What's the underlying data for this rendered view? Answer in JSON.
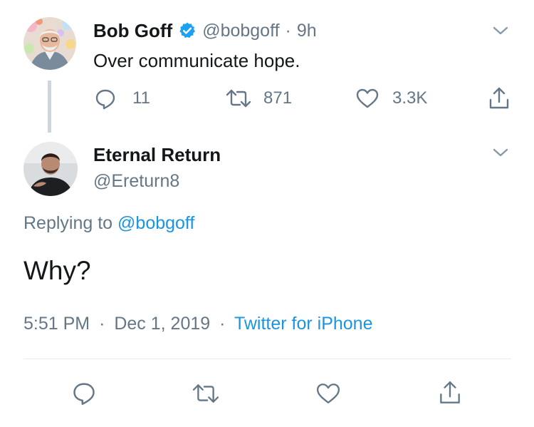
{
  "parent_tweet": {
    "author_name": "Bob Goff",
    "handle": "@bobgoff",
    "separator": "·",
    "time": "9h",
    "text": "Over communicate hope.",
    "verified_icon": "verified-badge-icon",
    "counts": {
      "replies": "11",
      "retweets": "871",
      "likes": "3.3K"
    }
  },
  "reply_tweet": {
    "author_name": "Eternal Return",
    "handle": "@Ereturn8",
    "replying_prefix": "Replying to",
    "replying_handle": "@bobgoff",
    "text": "Why?",
    "timestamp": "5:51 PM",
    "date": "Dec 1, 2019",
    "separator": "·",
    "source": "Twitter for iPhone"
  },
  "icons": {
    "reply": "reply-icon",
    "retweet": "retweet-icon",
    "like": "heart-icon",
    "share": "share-icon",
    "menu": "chevron-down-icon"
  },
  "colors": {
    "text": "#14171a",
    "muted": "#657786",
    "link": "#1b95e0",
    "verified": "#1da1f2",
    "divider": "#e6ecf0"
  }
}
